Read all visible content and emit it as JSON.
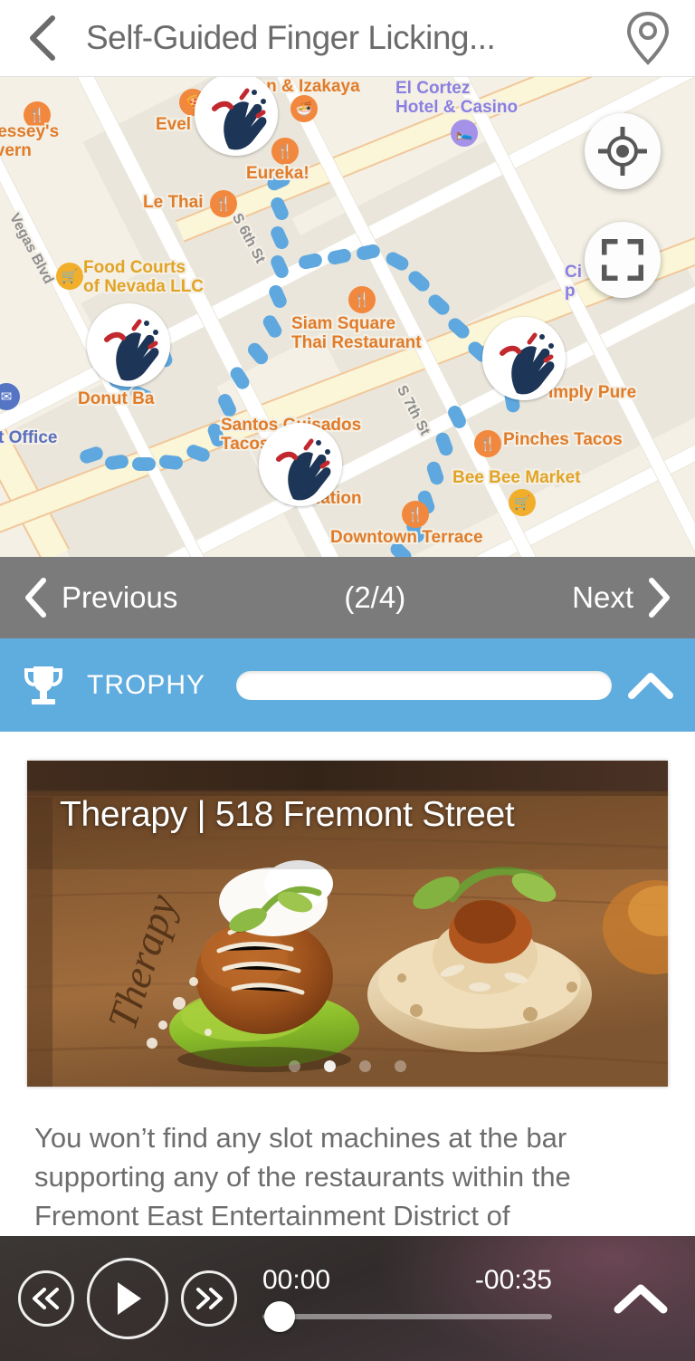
{
  "header": {
    "title": "Self-Guided Finger Licking...",
    "back_icon": "chevron-left-icon",
    "location_icon": "map-pin-icon"
  },
  "map": {
    "labels": [
      {
        "text": "nnessey's",
        "text2": "Tavern",
        "color": "#e07c2a"
      },
      {
        "text": "Evel",
        "color": "#e07c2a"
      },
      {
        "text": "hen & Izakaya",
        "color": "#e07c2a"
      },
      {
        "text": "El Cortez",
        "text2": "Hotel & Casino",
        "color": "#8a7fe0"
      },
      {
        "text": "Eureka!",
        "color": "#e07c2a"
      },
      {
        "text": "Le Thai",
        "color": "#e07c2a"
      },
      {
        "text": "S 6th St",
        "color": "#8e8e8e"
      },
      {
        "text": "Vegas Blvd",
        "color": "#8e8e8e"
      },
      {
        "text": "Food Courts",
        "text2": "of Nevada LLC",
        "color": "#e2a426"
      },
      {
        "text": "Siam Square",
        "text2": "Thai Restaurant",
        "color": "#e07c2a"
      },
      {
        "text": "Ci",
        "text2": "p",
        "color": "#8a7fe0"
      },
      {
        "text": "Donut Ba",
        "color": "#e07c2a"
      },
      {
        "text": "t Office",
        "color": "#5a6fc0"
      },
      {
        "text": "Santos Guisados",
        "text2": "Tacos & Beer",
        "color": "#e07c2a"
      },
      {
        "text": "imply Pure",
        "color": "#e07c2a"
      },
      {
        "text": "S 7th St",
        "color": "#8e8e8e"
      },
      {
        "text": "Pinches Tacos",
        "color": "#e07c2a"
      },
      {
        "text": "Bee Bee Market",
        "color": "#e2a426"
      },
      {
        "text": "V   Nation",
        "color": "#e07c2a"
      },
      {
        "text": "Downtown Terrace",
        "color": "#e07c2a"
      }
    ],
    "controls": {
      "locate_icon": "crosshair-locate-icon",
      "fullscreen_icon": "expand-fullscreen-icon"
    },
    "route_color": "#5fa8df",
    "marker_count": 4
  },
  "nav": {
    "previous_label": "Previous",
    "next_label": "Next",
    "counter": "(2/4)",
    "prev_icon": "chevron-left-icon",
    "next_icon": "chevron-right-icon",
    "background_color": "#7b7b7b"
  },
  "trophy": {
    "label": "TROPHY",
    "icon": "trophy-icon",
    "progress_percent": 100,
    "collapse_icon": "chevron-up-icon",
    "background_color": "#5facdf"
  },
  "content": {
    "photo_title": "Therapy | 518 Fremont Street",
    "carousel": {
      "total": 4,
      "active_index": 1
    },
    "body_text": "You won’t find any slot machines at the bar supporting any of the restaurants within the Fremont East Entertainment District of"
  },
  "player": {
    "rewind_icon": "rewind-icon",
    "play_icon": "play-icon",
    "forward_icon": "fast-forward-icon",
    "elapsed_time": "00:00",
    "remaining_time": "-00:35",
    "progress_percent": 0,
    "collapse_icon": "chevron-up-icon"
  }
}
